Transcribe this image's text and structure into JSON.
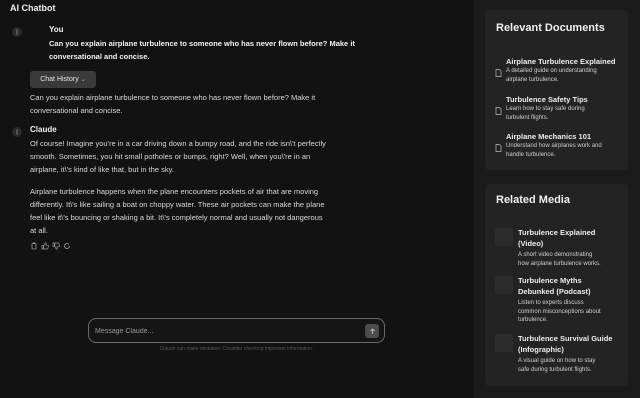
{
  "app": {
    "title": "AI Chatbot"
  },
  "conversation": {
    "user_message": {
      "author": "You",
      "text_line1": "Can you explain airplane turbulence to someone who has never flown before? Make it",
      "text_line2": "conversational and concise."
    },
    "history_button": {
      "label": "Chat History",
      "icon": "chevron-down-icon"
    },
    "echo": {
      "line1": "Can you explain airplane turbulence to someone who has never flown before? Make it",
      "line2": "conversational and concise."
    },
    "assistant_message": {
      "author": "Claude",
      "paragraph1": [
        "Of course! Imagine you're in a car driving down a bumpy road, and the ride isn\\'t perfectly",
        "smooth. Sometimes, you hit small potholes or bumps, right? Well, when you\\'re in an",
        "airplane, it\\'s kind of like that, but in the sky."
      ],
      "paragraph2": [
        "Airplane turbulence happens when the plane encounters pockets of air that are moving",
        "differently. It\\'s like sailing a boat on choppy water. These air pockets can make the plane",
        "feel like it\\'s bouncing or shaking a bit. It\\'s completely normal and usually not dangerous",
        "at all."
      ]
    },
    "message_actions": [
      "copy-icon",
      "thumbs-up-icon",
      "thumbs-down-icon",
      "retry-icon"
    ]
  },
  "composer": {
    "placeholder": "Message Claude...",
    "value": "",
    "disclaimer": "Claude can make mistakes. Consider checking important information."
  },
  "sidebar": {
    "documents": {
      "title": "Relevant Documents",
      "items": [
        {
          "title": "Airplane Turbulence Explained",
          "desc_line1": "A detailed guide on understanding",
          "desc_line2": "airplane turbulence."
        },
        {
          "title": "Turbulence Safety Tips",
          "desc_line1": "Learn how to stay safe during",
          "desc_line2": "turbulent flights."
        },
        {
          "title": "Airplane Mechanics 101",
          "desc_line1": "Understand how airplanes work and",
          "desc_line2": "handle turbulence."
        }
      ]
    },
    "media": {
      "title": "Related Media",
      "items": [
        {
          "title_line1": "Turbulence Explained",
          "title_line2": "(Video)",
          "desc_line1": "A short video demonstrating",
          "desc_line2": "how airplane turbulence works.",
          "desc_line3": ""
        },
        {
          "title_line1": "Turbulence Myths",
          "title_line2": "Debunked (Podcast)",
          "desc_line1": "Listen to experts discuss",
          "desc_line2": "common misconceptions about",
          "desc_line3": "turbulence."
        },
        {
          "title_line1": "Turbulence Survival Guide",
          "title_line2": "(Infographic)",
          "desc_line1": "A visual guide on how to stay",
          "desc_line2": "safe during turbulent flights.",
          "desc_line3": ""
        }
      ]
    }
  },
  "colors": {
    "background": "#121212",
    "sidebar": "#1b1b1b",
    "card": "#232323",
    "button": "#3a3a3a"
  }
}
